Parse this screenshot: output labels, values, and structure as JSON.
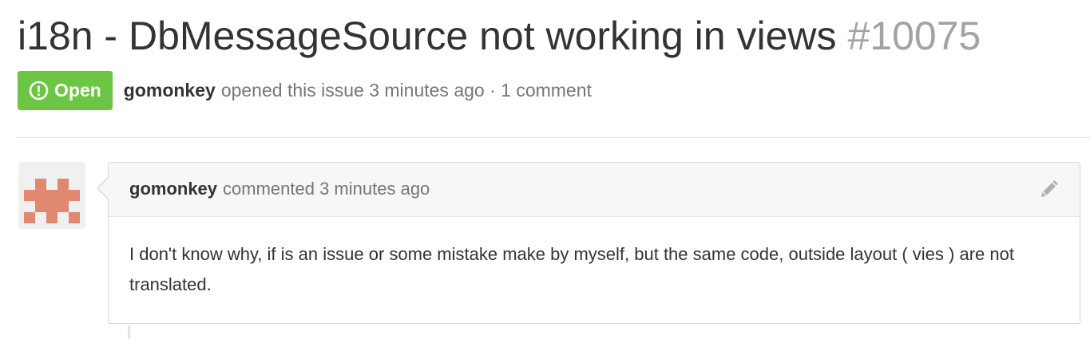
{
  "issue": {
    "title": "i18n - DbMessageSource not working in views",
    "number": "#10075",
    "state_label": "Open",
    "author": "gomonkey",
    "opened_text": "opened this issue 3 minutes ago · 1 comment"
  },
  "comment": {
    "author": "gomonkey",
    "timestamp_text": "commented 3 minutes ago",
    "body": "I don't know why, if is an issue or some mistake make by myself, but the same code, outside layout ( vies ) are not translated."
  },
  "icons": {
    "state": "issue-opened-icon",
    "edit": "pencil-icon",
    "avatar": "identicon-avatar"
  },
  "colors": {
    "open_badge": "#6cc644",
    "avatar_pattern": "#e08870",
    "issue_number": "#a3a3a3"
  }
}
